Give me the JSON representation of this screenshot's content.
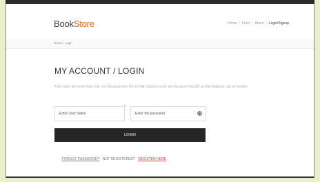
{
  "browser": {
    "top_text": "",
    "top_right_text": ""
  },
  "header": {
    "logo_part1": "Book",
    "logo_part2": "Store",
    "nav": [
      "Home",
      "Feed",
      "About",
      "Login/Signup"
    ]
  },
  "breadcrumb": "Home / Login",
  "page": {
    "title": "MY ACCOUNT / LOGIN",
    "subtitle": "Fairy tales are more than true: not because they tell us that dragons exist, but because they tell us that dragons can be beaten."
  },
  "form": {
    "username_placeholder": "Enter User Name",
    "password_placeholder": "Enter the password",
    "login_label": "LOGIN"
  },
  "footer_links": {
    "forgot": "FORGOT PASSWORD?",
    "not_registered": "NOT REGISTERED?",
    "register": "REGISTER HERE"
  },
  "colors": {
    "accent": "#e8632b",
    "link_red": "#e23b3b",
    "button_bg": "#262626"
  }
}
